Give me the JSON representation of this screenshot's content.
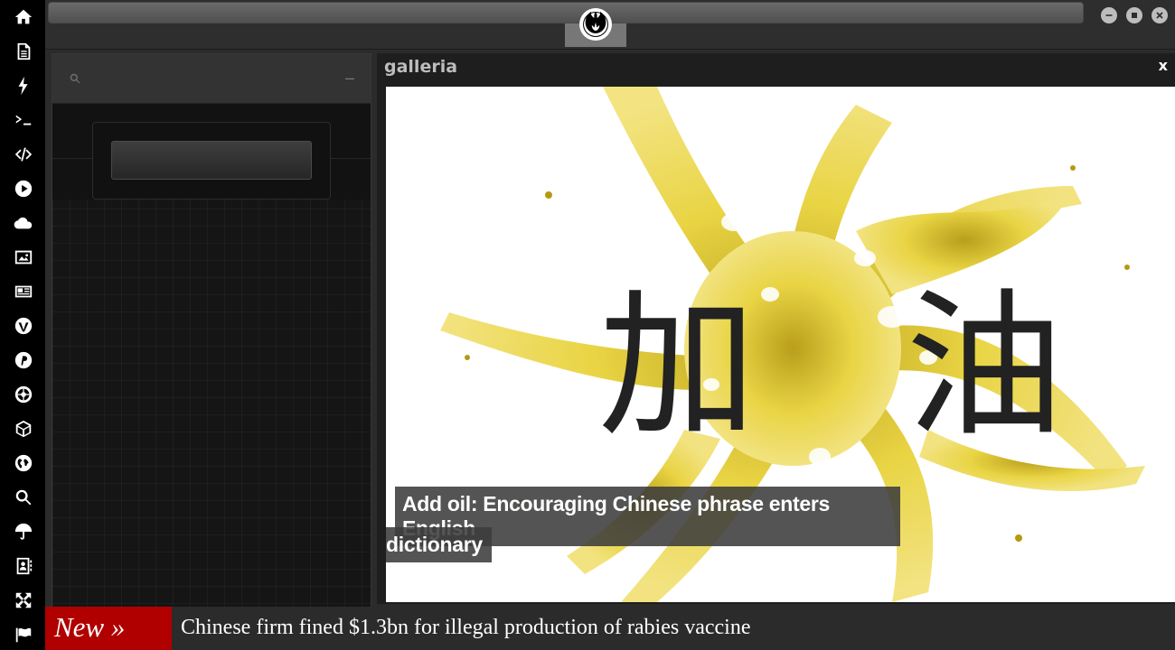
{
  "sidebar": {
    "icons": [
      "home-icon",
      "document-icon",
      "lightning-icon",
      "terminal-icon",
      "code-icon",
      "play-icon",
      "cloud-icon",
      "image-icon",
      "newspaper-icon",
      "wordpress-icon",
      "pinterest-icon",
      "galactic-empire-icon",
      "death-star-icon",
      "globe-icon",
      "search-icon",
      "umbrella-icon",
      "contacts-icon",
      "expand-icon",
      "flag-icon"
    ]
  },
  "topbar": {
    "logo_icon": "rebel-alliance-icon",
    "window_buttons": [
      "minimize-icon",
      "restore-icon",
      "close-icon"
    ]
  },
  "left_panel": {
    "search_icon": "search-icon",
    "minimize_label": "–"
  },
  "gallery": {
    "title": "galleria",
    "close_label": "x",
    "caption_line1": "Add oil: Encouraging Chinese phrase enters English",
    "caption_line2": "dictionary",
    "image_text_left": "加",
    "image_text_right": "油"
  },
  "ticker": {
    "label": "New »",
    "headline": "Chinese firm fined $1.3bn for illegal production of rabies vaccine"
  },
  "colors": {
    "ticker_accent": "#b00000",
    "oil_yellow": "#e8d23a"
  }
}
